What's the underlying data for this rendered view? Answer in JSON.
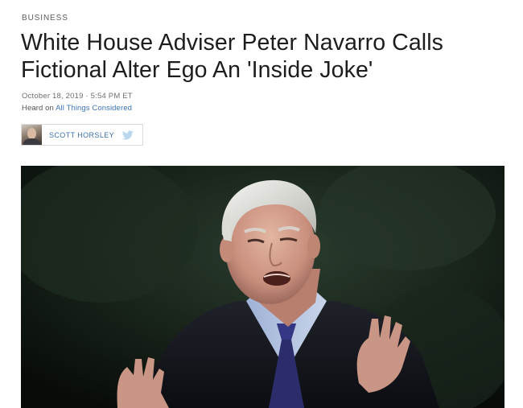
{
  "article": {
    "section": "BUSINESS",
    "headline_line1": "White House Adviser Peter Navarro Calls",
    "headline_line2": "Fictional Alter Ego An 'Inside Joke'",
    "dateline": "October 18, 2019 · 5:54 PM ET",
    "heard_on_prefix": "Heard on ",
    "heard_on_program": "All Things Considered",
    "author": {
      "name": "SCOTT HORSLEY",
      "social_icon": "twitter-icon"
    },
    "hero_image": {
      "subject": "photo-of-peter-navarro"
    }
  },
  "colors": {
    "link": "#3b73b3",
    "headline": "#1d1d1d",
    "meta": "#6f6f6f",
    "twitter": "#b9d8ef"
  }
}
